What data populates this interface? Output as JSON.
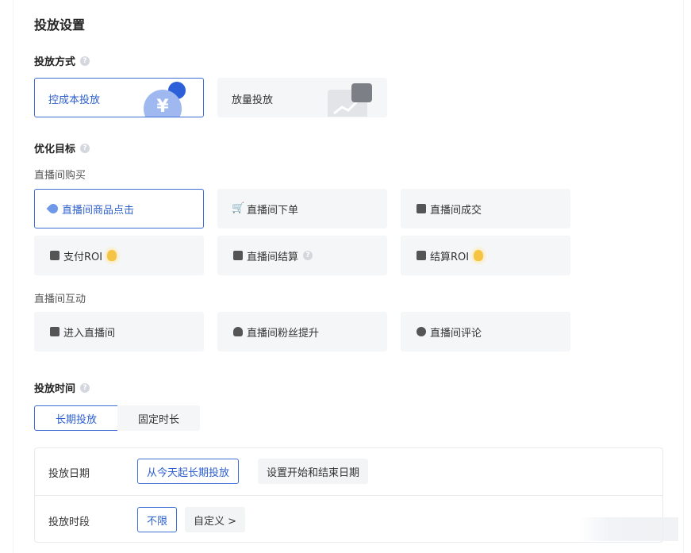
{
  "page_title": "投放设置",
  "delivery_method": {
    "label": "投放方式",
    "help": "?",
    "options": [
      {
        "label": "控成本投放",
        "selected": true,
        "icon": "yen-coin-icon",
        "icon_glyph": "¥"
      },
      {
        "label": "放量投放",
        "selected": false,
        "icon": "growth-chart-icon"
      }
    ]
  },
  "optimization_goal": {
    "label": "优化目标",
    "help": "?",
    "group1": {
      "label": "直播间购买",
      "items": [
        {
          "label": "直播间商品点击",
          "selected": true,
          "icon": "pin-click-icon"
        },
        {
          "label": "直播间下单",
          "selected": false,
          "icon": "cart-icon"
        },
        {
          "label": "直播间成交",
          "selected": false,
          "icon": "bag-icon"
        },
        {
          "label": "支付ROI",
          "selected": false,
          "icon": "wallet-icon",
          "badge": "bulb-icon"
        },
        {
          "label": "直播间结算",
          "selected": false,
          "icon": "checkbox-icon",
          "help": "?"
        },
        {
          "label": "结算ROI",
          "selected": false,
          "icon": "cash-icon",
          "badge": "bulb-icon"
        }
      ]
    },
    "group2": {
      "label": "直播间互动",
      "items": [
        {
          "label": "进入直播间",
          "selected": false,
          "icon": "tv-icon"
        },
        {
          "label": "直播间粉丝提升",
          "selected": false,
          "icon": "user-plus-icon"
        },
        {
          "label": "直播间评论",
          "selected": false,
          "icon": "comment-icon"
        }
      ]
    }
  },
  "delivery_time": {
    "label": "投放时间",
    "help": "?",
    "tabs": [
      {
        "label": "长期投放",
        "selected": true
      },
      {
        "label": "固定时长",
        "selected": false
      }
    ],
    "date_row": {
      "label": "投放日期",
      "options": [
        {
          "label": "从今天起长期投放",
          "selected": true
        },
        {
          "label": "设置开始和结束日期",
          "selected": false
        }
      ]
    },
    "period_row": {
      "label": "投放时段",
      "options": [
        {
          "label": "不限",
          "selected": true
        },
        {
          "label": "自定义 >",
          "selected": false
        }
      ]
    }
  },
  "colors": {
    "accent": "#2d5fcf",
    "card_bg": "#f5f6f8",
    "border": "#e9eaee"
  }
}
